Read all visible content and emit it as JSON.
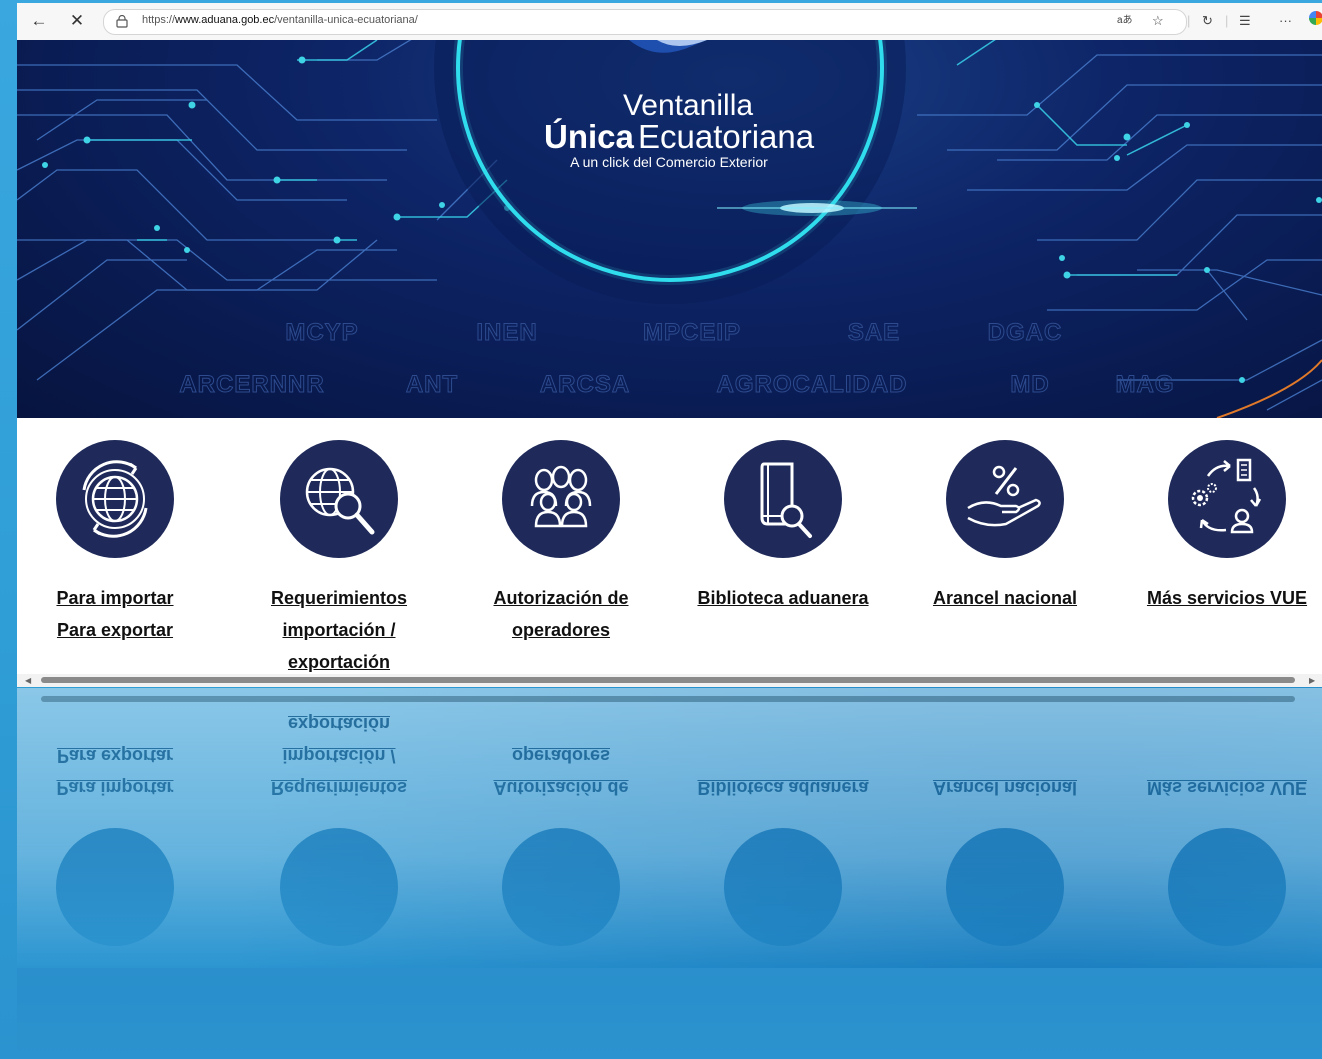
{
  "browser": {
    "back_icon": "arrow-left-icon",
    "close_icon": "close-icon",
    "lock_icon": "lock-icon",
    "url_prefix": "https://",
    "url_host": "www.aduana.gob.ec",
    "url_path": "/ventanilla-unica-ecuatoriana/",
    "right_icons": [
      "read-aloud-icon",
      "favorite-star-icon",
      "refresh-icon",
      "favorites-list-icon",
      "more-icon"
    ]
  },
  "banner": {
    "title_line1": "Ventanilla",
    "title_bold": "Única",
    "title_rest": "Ecuatoriana",
    "subtitle": "A un click del Comercio Exterior",
    "agencies_row1": [
      "MCYP",
      "INEN",
      "MPCEIP",
      "SAE",
      "DGAC"
    ],
    "agencies_row2": [
      "ARCERNNR",
      "ANT",
      "ARCSA",
      "AGROCALIDAD",
      "MD",
      "MAG"
    ]
  },
  "services": [
    {
      "icon": "globe-cycle-icon",
      "links": [
        "Para importar",
        "Para exportar"
      ]
    },
    {
      "icon": "globe-search-icon",
      "links": [
        "Requerimientos",
        "importación /",
        "exportación"
      ]
    },
    {
      "icon": "people-group-icon",
      "links": [
        "Autorización de",
        "operadores"
      ]
    },
    {
      "icon": "book-search-icon",
      "links": [
        "Biblioteca aduanera"
      ]
    },
    {
      "icon": "hand-percent-icon",
      "links": [
        "Arancel nacional"
      ]
    },
    {
      "icon": "process-cycle-icon",
      "links": [
        "Más servicios VUE"
      ]
    }
  ],
  "colors": {
    "page_bg": "#2f9fd8",
    "banner_bg": "#0d2466",
    "accent_cyan": "#3fd3e6",
    "icon_circle": "#1f2a5a"
  }
}
